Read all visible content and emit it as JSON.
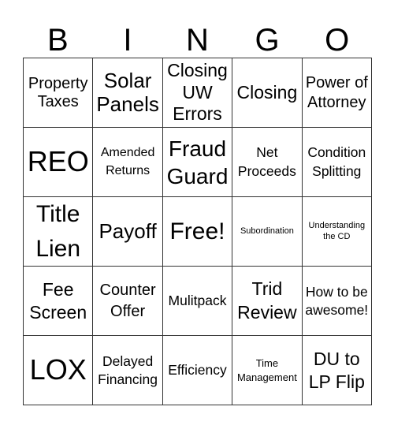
{
  "header": [
    "B",
    "I",
    "N",
    "G",
    "O"
  ],
  "cells": [
    [
      "Property Taxes",
      "Solar Panels",
      "Closing UW Errors",
      "Closing",
      "Power of Attorney"
    ],
    [
      "REO",
      "Amended Returns",
      "Fraud Guard",
      "Net Proceeds",
      "Condition Splitting"
    ],
    [
      "Title Lien",
      "Payoff",
      "Free!",
      "Subordination",
      "Understanding the CD"
    ],
    [
      "Fee Screen",
      "Counter Offer",
      "Mulitpack",
      "Trid Review",
      "How to be awesome!"
    ],
    [
      "LOX",
      "Delayed Financing",
      "Efficiency",
      "Time Management",
      "DU to LP Flip"
    ]
  ]
}
